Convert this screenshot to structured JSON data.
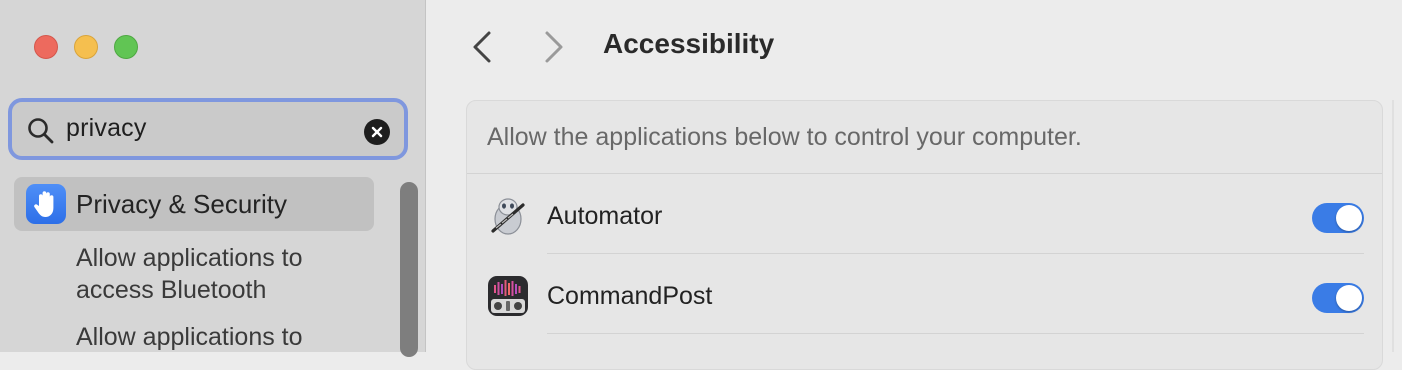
{
  "window": {
    "traffic_lights": [
      "close",
      "minimize",
      "zoom"
    ]
  },
  "sidebar": {
    "search": {
      "value": "privacy",
      "placeholder": "Search"
    },
    "results": [
      {
        "label": "Privacy & Security",
        "icon": "hand-raised-icon",
        "selected": true
      },
      {
        "label_line1": "Allow applications to",
        "label_line2": "access Bluetooth"
      },
      {
        "label_line1": "Allow applications to"
      }
    ]
  },
  "header": {
    "title": "Accessibility"
  },
  "panel": {
    "description": "Allow the applications below to control your computer.",
    "apps": [
      {
        "name": "Automator",
        "icon": "automator-robot-icon",
        "enabled": true
      },
      {
        "name": "CommandPost",
        "icon": "commandpost-app-icon",
        "enabled": true
      }
    ]
  },
  "colors": {
    "accent": "#3a7ce6",
    "focus_ring": "#7f97de",
    "close": "#ed6a5e",
    "minimize": "#f5bf4f",
    "zoom": "#61c554"
  }
}
